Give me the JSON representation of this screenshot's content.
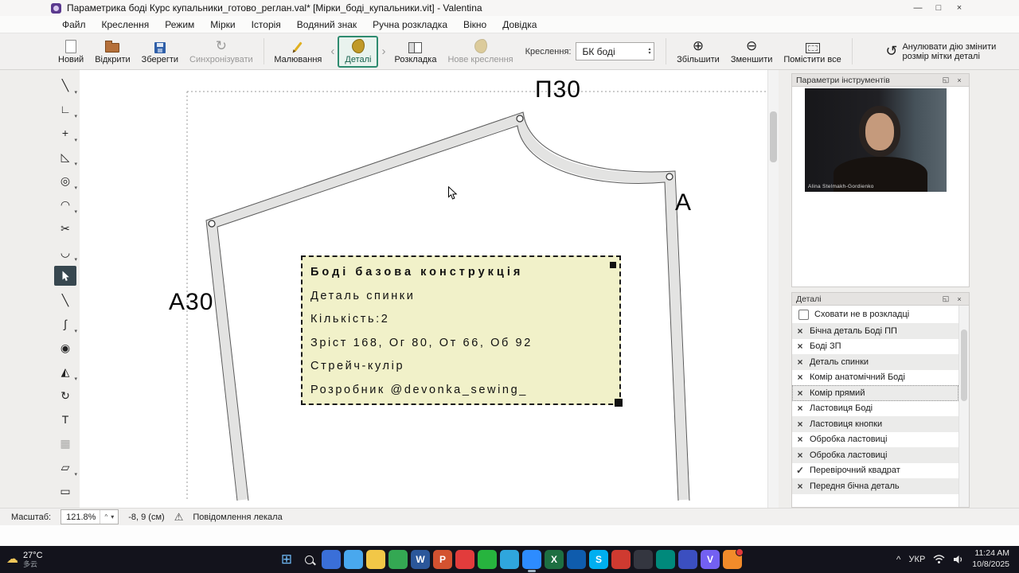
{
  "window": {
    "title": "Параметрика боді Курс купальники_готово_реглан.val* [Мірки_боді_купальники.vit] - Valentina"
  },
  "icons": {
    "minimize": "—",
    "maximize": "□",
    "close": "×",
    "float": "◱",
    "back": "‹",
    "forward": "›",
    "spin_up": "▴",
    "spin_down": "▾",
    "dropdown_small": "▾",
    "zoom_in": "⊕",
    "zoom_out": "⊖",
    "undo": "↺",
    "sync": "↻",
    "warning": "⚠",
    "chevron_up": "^",
    "check": "✓",
    "cross": "×",
    "cloud": "☁"
  },
  "menu": {
    "items": [
      "Файл",
      "Креслення",
      "Режим",
      "Мірки",
      "Історія",
      "Водяний знак",
      "Ручна розкладка",
      "Вікно",
      "Довідка"
    ]
  },
  "toolbar": {
    "new": "Новий",
    "open": "Відкрити",
    "save": "Зберегти",
    "sync": "Синхронізувати",
    "draw_mode": "Малювання",
    "details_mode": "Деталі",
    "layout_mode": "Розкладка",
    "new_pattern": "Нове креслення",
    "pattern_label": "Креслення:",
    "pattern_value": "БК боді",
    "zoom_in": "Збільшити",
    "zoom_out": "Зменшити",
    "fit_all": "Помістити все",
    "undo": "Анулювати дію змінити розмір мітки деталі"
  },
  "left_tools": [
    {
      "name": "line-tool",
      "glyph": "╲",
      "dropdown": true
    },
    {
      "name": "perpendicular-point-tool",
      "glyph": "∟",
      "dropdown": true
    },
    {
      "name": "move-point-tool",
      "glyph": "+",
      "dropdown": true
    },
    {
      "name": "triangle-tool",
      "glyph": "◺",
      "dropdown": true
    },
    {
      "name": "point-intersect-tool",
      "glyph": "◎",
      "dropdown": true
    },
    {
      "name": "curve-tool",
      "glyph": "◠",
      "dropdown": true
    },
    {
      "name": "scissors-tool",
      "glyph": "✂"
    },
    {
      "name": "arc-tool",
      "glyph": "◡",
      "dropdown": true
    },
    {
      "name": "pointer-tool",
      "cursor": true,
      "active": true
    },
    {
      "name": "line-between-points-tool",
      "glyph": "╲"
    },
    {
      "name": "spline-tool",
      "glyph": "∫",
      "dropdown": true
    },
    {
      "name": "group-tool",
      "glyph": "◉"
    },
    {
      "name": "mirror-tool",
      "glyph": "◭",
      "dropdown": true
    },
    {
      "name": "rotate-tool",
      "glyph": "↻"
    },
    {
      "name": "true-darts-tool",
      "glyph": "T"
    },
    {
      "name": "insert-image-tool",
      "glyph": "▦",
      "disabled": true
    },
    {
      "name": "union-tool",
      "glyph": "▱",
      "dropdown": true
    },
    {
      "name": "export-tool",
      "glyph": "▭"
    }
  ],
  "canvas": {
    "point_labels": {
      "top": "П30",
      "right": "А",
      "left": "А30"
    },
    "info_box": {
      "title": "Боді базова конструкція",
      "lines": [
        "Деталь спинки",
        "Кількість:2",
        "Зріст 168, Ог 80, От 66, Об 92",
        "Стрейч-кулір",
        "Розробник @devonka_sewing_"
      ]
    }
  },
  "panels": {
    "tool_options": {
      "title": "Параметри інструментів",
      "webcam_caption": "Alina Stelmakh-Gordienko"
    },
    "details": {
      "title": "Деталі",
      "hide_option": "Сховати не в розкладці",
      "items": [
        {
          "state": "x",
          "label": "Бічна деталь Боді ПП"
        },
        {
          "state": "x",
          "label": "Боді ЗП"
        },
        {
          "state": "x",
          "label": "Деталь спинки"
        },
        {
          "state": "x",
          "label": "Комір анатомічний Боді"
        },
        {
          "state": "x",
          "label": "Комір прямий",
          "focused": true
        },
        {
          "state": "x",
          "label": "Ластовиця Боді"
        },
        {
          "state": "x",
          "label": "Ластовиця кнопки"
        },
        {
          "state": "x",
          "label": "Обробка ластовиці"
        },
        {
          "state": "x",
          "label": "Обробка ластовиці"
        },
        {
          "state": "check",
          "label": "Перевірочний квадрат"
        },
        {
          "state": "x",
          "label": "Передня бічна деталь"
        }
      ]
    }
  },
  "statusbar": {
    "scale_label": "Масштаб:",
    "scale_value": "121.8%",
    "coords": "-8, 9 (см)",
    "notice": "Повідомлення лекала"
  },
  "taskbar": {
    "weather_temp": "27°C",
    "weather_desc": "多云",
    "apps": [
      {
        "name": "start-button",
        "glyph": "⊞",
        "color": "transparent",
        "fg": "#6fb9f5"
      },
      {
        "name": "search-button",
        "search": true,
        "color": "transparent"
      },
      {
        "name": "taskbar-app-1",
        "color": "#3a6fd8"
      },
      {
        "name": "taskbar-app-2",
        "color": "#49a8ee"
      },
      {
        "name": "taskbar-app-3",
        "color": "#f2c747"
      },
      {
        "name": "taskbar-app-4",
        "color": "#34a853"
      },
      {
        "name": "taskbar-app-5",
        "color": "#2b579a",
        "glyph": "W"
      },
      {
        "name": "taskbar-app-6",
        "color": "#d35230",
        "glyph": "P"
      },
      {
        "name": "taskbar-app-7",
        "color": "#e23c3c"
      },
      {
        "name": "taskbar-app-8",
        "color": "#27b43e"
      },
      {
        "name": "taskbar-app-9",
        "color": "#2fa6dd"
      },
      {
        "name": "taskbar-app-10",
        "color": "#2d8cff",
        "active": true
      },
      {
        "name": "taskbar-app-11",
        "color": "#1d6f42",
        "glyph": "X"
      },
      {
        "name": "taskbar-app-12",
        "color": "#0f5cad"
      },
      {
        "name": "taskbar-app-13",
        "color": "#00aff0",
        "glyph": "S"
      },
      {
        "name": "taskbar-app-14",
        "color": "#cf3a30"
      },
      {
        "name": "taskbar-app-15",
        "color": "#343640"
      },
      {
        "name": "taskbar-app-16",
        "color": "#00897b"
      },
      {
        "name": "taskbar-app-17",
        "color": "#3b4fc0"
      },
      {
        "name": "taskbar-app-18",
        "color": "#7360f2",
        "glyph": "V"
      },
      {
        "name": "taskbar-app-19",
        "color": "#f28b2a",
        "badge": true
      }
    ],
    "tray": {
      "lang": "УКР",
      "time": "11:24 AM",
      "date": "10/8/2025"
    }
  }
}
